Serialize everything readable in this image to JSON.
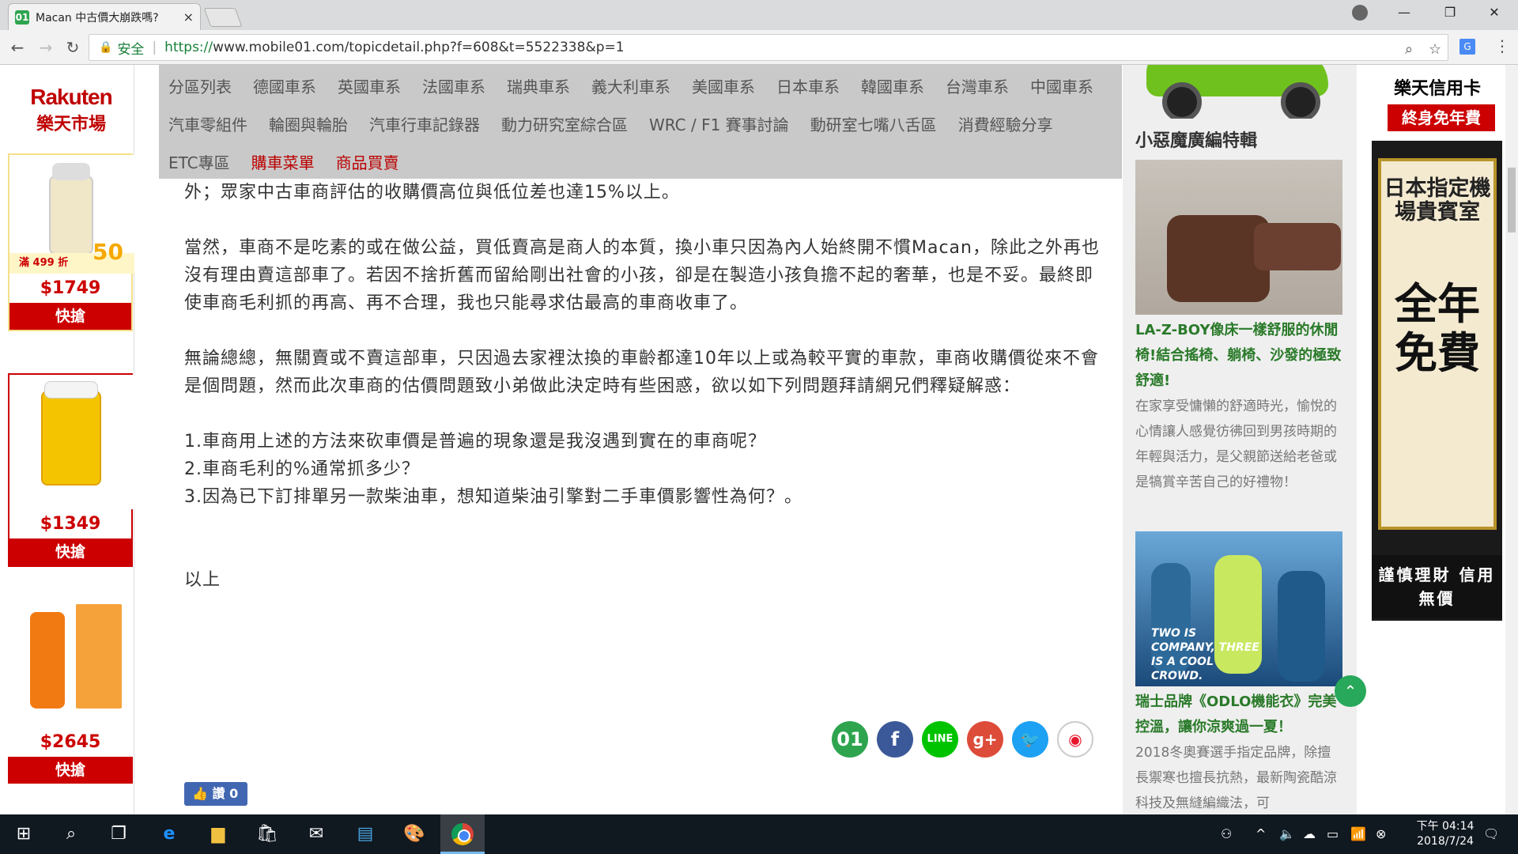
{
  "browser": {
    "tab_title": "Macan 中古價大崩跌嗎?",
    "tab_close": "×",
    "secure_label": "安全",
    "url_scheme": "https://",
    "url_host": "www.mobile01.com",
    "url_path": "/topicdetail.php?f=608&t=5522338&p=1",
    "window_controls": [
      "—",
      "❐",
      "✕"
    ]
  },
  "left_ad": {
    "logo_en": "Rakuten",
    "logo_zh": "樂天市場",
    "products": [
      {
        "price": "$1749",
        "buy": "快搶",
        "promo": "滿 499 折",
        "promo_big": "50"
      },
      {
        "price": "$1349",
        "buy": "快搶"
      },
      {
        "price": "$2645",
        "buy": "快搶"
      }
    ]
  },
  "nav": {
    "row1": [
      "分區列表",
      "德國車系",
      "英國車系",
      "法國車系",
      "瑞典車系",
      "義大利車系",
      "美國車系",
      "日本車系",
      "韓國車系",
      "台灣車系",
      "中國車系"
    ],
    "row2": [
      "汽車零組件",
      "輪圈與輪胎",
      "汽車行車記錄器",
      "動力研究室綜合區",
      "WRC / F1 賽事討論",
      "動研室七嘴八舌區",
      "消費經驗分享"
    ],
    "row3": [
      "ETC專區",
      "購車菜單",
      "商品買賣"
    ]
  },
  "article": {
    "p1": "也類似，這才讓我明白眾車商們收車手法幾乎如出一轍。不過在比較過網路上Macan S D中古車售價(牌價) ，再對比車商報出的收購價後，小弟發現收購價與可能售出的價格(牌價)落差相當大，也就是車商的毛利抓蠻高的！另外；眾家中古車商評估的收購價高位與低位差也達15%以上。",
    "p2": "當然，車商不是吃素的或在做公益，買低賣高是商人的本質，換小車只因為內人始終開不慣Macan，除此之外再也沒有理由賣這部車了。若因不捨折舊而留給剛出社會的小孩，卻是在製造小孩負擔不起的奢華，也是不妥。最終即使車商毛利抓的再高、再不合理，我也只能尋求估最高的車商收車了。",
    "p3": "無論總總，無關賣或不賣這部車，只因過去家裡汰換的車齡都達10年以上或為較平實的車款，車商收購價從來不會是個問題，然而此次車商的估價問題致小弟做此決定時有些困惑，欲以如下列問題拜請網兄們釋疑解惑：",
    "q1": "1.車商用上述的方法來砍車價是普遍的現象還是我沒遇到實在的車商呢？",
    "q2": "2.車商毛利的%通常抓多少？",
    "q3": "3.因為已下訂排單另一款柴油車，想知道柴油引擎對二手車價影響性為何？。",
    "closing": "以上",
    "like_label": "讚 0"
  },
  "right": {
    "section_title": "小惡魔廣編特輯",
    "feature1_title": "LA-Z-BOY像床一樣舒服的休閒椅!結合搖椅、躺椅、沙發的極致舒適!",
    "feature1_desc": "在家享受慵懶的舒適時光，愉悅的心情讓人感覺彷彿回到男孩時期的年輕與活力，是父親節送給老爸或是犒賞辛苦自己的好禮物！",
    "feature2_title": "瑞士品牌《ODLO機能衣》完美控溫，讓你涼爽過一夏！",
    "feature2_desc": "2018冬奧賽選手指定品牌，除擅長禦寒也擅長抗熱，最新陶瓷酷涼科技及無縫編織法，可",
    "feature2_slogan": "TWO IS COMPANY, THREE IS A COOL CROWD."
  },
  "right_ad": {
    "top_line": "樂天信用卡",
    "badge": "終身免年費",
    "sign_small": "日本指定機場貴賓室",
    "sign_big": "全年免費",
    "footer": "謹慎理財 信用無價"
  },
  "taskbar": {
    "time": "下午 04:14",
    "date": "2018/7/24"
  },
  "colors": {
    "nav_bg": "#c9c9c9",
    "nav_highlight": "#b00000",
    "rakuten_red": "#bf0000",
    "feature_title_green": "#2a7a2a"
  }
}
